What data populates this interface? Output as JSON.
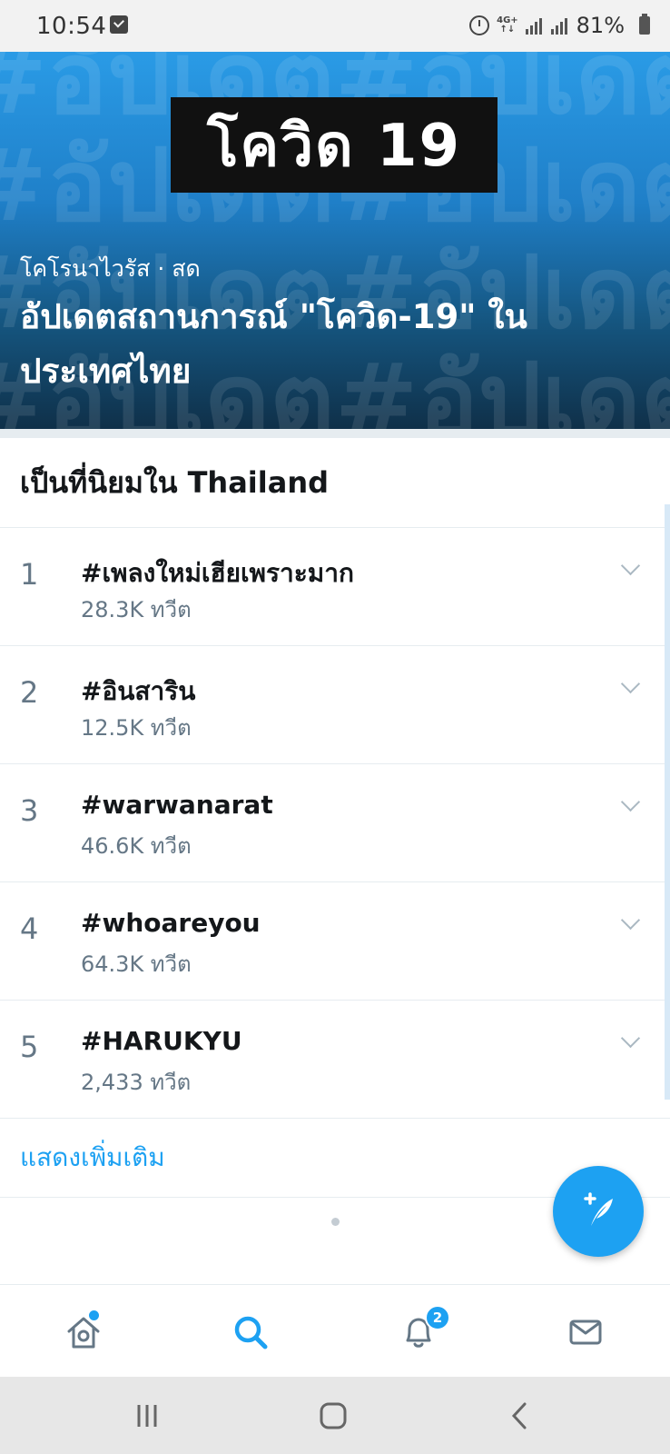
{
  "status_bar": {
    "time": "10:54",
    "network": "4G+",
    "battery": "81%"
  },
  "hero": {
    "badge": "โควิด 19",
    "background_text": "#อัปเดต",
    "meta": "โคโรนาไวรัส · สด",
    "title": "อัปเดตสถานการณ์ \"โควิด-19\" ในประเทศไทย"
  },
  "trends": {
    "header": "เป็นที่นิยมใน Thailand",
    "items": [
      {
        "rank": "1",
        "tag": "#เพลงใหม่เฮียเพราะมาก",
        "count": "28.3K ทวีต"
      },
      {
        "rank": "2",
        "tag": "#อินสาริน",
        "count": "12.5K ทวีต"
      },
      {
        "rank": "3",
        "tag": "#warwanarat",
        "count": "46.6K ทวีต"
      },
      {
        "rank": "4",
        "tag": "#whoareyou",
        "count": "64.3K ทวีต"
      },
      {
        "rank": "5",
        "tag": "#HARUKYU",
        "count": "2,433 ทวีต"
      }
    ],
    "show_more": "แสดงเพิ่มเติม"
  },
  "fab": {
    "icon": "compose-tweet-icon"
  },
  "bottom_nav": {
    "items": [
      {
        "name": "home",
        "icon": "home-icon",
        "has_dot": true
      },
      {
        "name": "search",
        "icon": "search-icon",
        "active": true
      },
      {
        "name": "notifications",
        "icon": "bell-icon",
        "badge": "2"
      },
      {
        "name": "messages",
        "icon": "mail-icon"
      }
    ]
  },
  "colors": {
    "accent": "#1da1f2",
    "text": "#14171a",
    "secondary": "#657786",
    "divider": "#e6ecf0"
  }
}
